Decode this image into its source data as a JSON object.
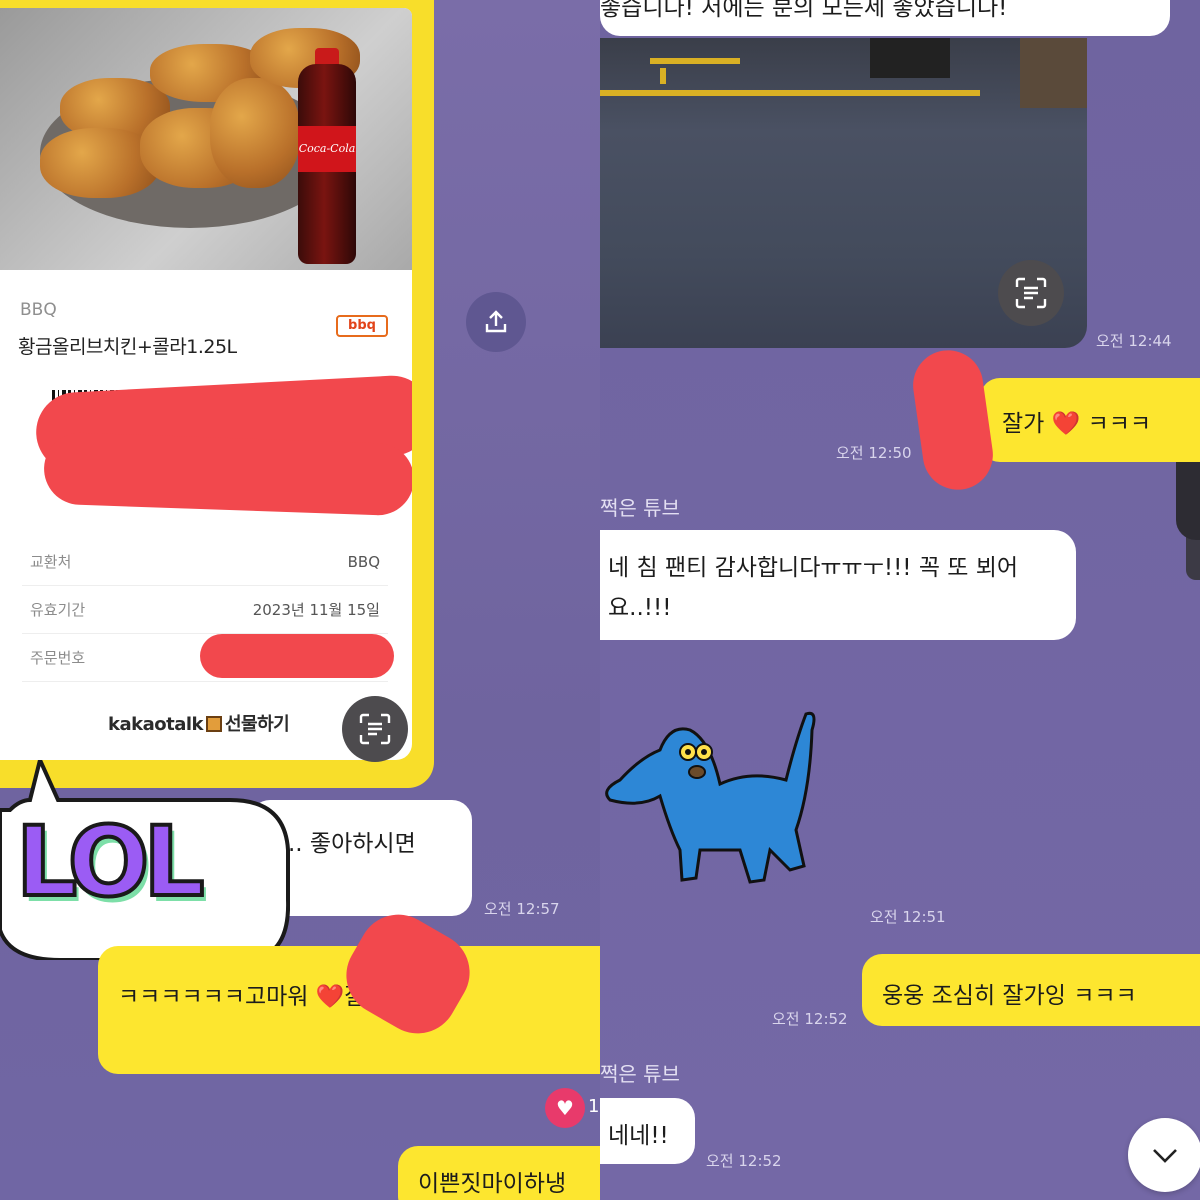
{
  "left": {
    "gift": {
      "brand": "BBQ",
      "product": "황금올리브치킨+콜라1.25L",
      "logo_text": "bbq",
      "bottle_text": "Coca-Cola",
      "rows": [
        {
          "label": "교환처",
          "value": "BBQ"
        },
        {
          "label": "유효기간",
          "value": "2023년 11월 15일"
        },
        {
          "label": "주문번호",
          "value": ""
        }
      ],
      "footer_brand": "kakaotalk",
      "footer_action": "선물하기"
    },
    "messages": {
      "white_text": ".. 좋아하시면",
      "white_time": "오전 12:57",
      "sticker_text": "LOL",
      "yellow1_text": "ㅋㅋㅋㅋㅋㅋ고마워 ❤️잘먹을게",
      "like_count": "1",
      "yellow2_text": "이쁜짓마이하냉"
    }
  },
  "right": {
    "top_text": "좋습니다! 저에는 분의 모든세 좋았습니다!",
    "photo_time": "오전 12:44",
    "m1_text": "잘가 ❤️ ㅋㅋㅋ",
    "m1_time": "오전 12:50",
    "sender": "쩍은 튜브",
    "m2_text": "네 침 팬티 감사합니다ㅠㅠㅜ!!! 꼭 또 뵈어요..!!!",
    "sticker_time": "오전 12:51",
    "m3_text": "웅웅 조심히 잘가잉 ㅋㅋㅋ",
    "m3_time": "오전 12:52",
    "sender2": "쩍은 튜브",
    "m4_text": "네네!!",
    "m4_time": "오전 12:52"
  },
  "colors": {
    "chat_bg": "#7468a6",
    "my_bubble": "#fde62f",
    "their_bubble": "#ffffff",
    "redaction": "#f2484d"
  },
  "icons": [
    "share-icon",
    "ocr-scan-icon",
    "heart-icon",
    "chevron-down-icon"
  ]
}
